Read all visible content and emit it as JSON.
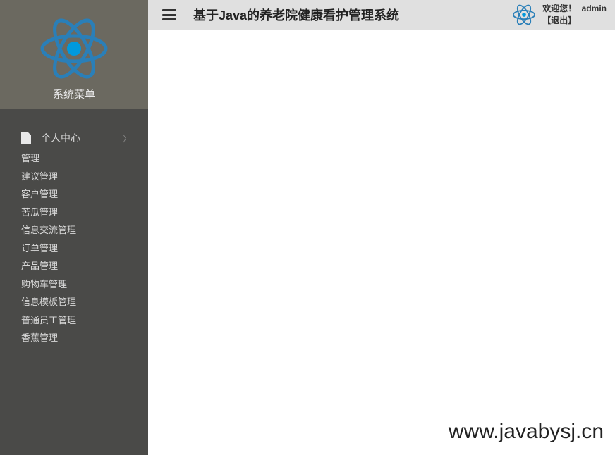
{
  "sidebar": {
    "title": "系统菜单",
    "parent_item": "个人中心",
    "items": [
      "管理",
      "建议管理",
      "客户管理",
      "苦瓜管理",
      "信息交流管理",
      "订单管理",
      "产品管理",
      "购物车管理",
      "信息模板管理",
      "普通员工管理",
      "香蕉管理"
    ]
  },
  "header": {
    "title": "基于Java的养老院健康看护管理系统",
    "welcome_prefix": "欢迎您！",
    "username": "admin",
    "logout": "【退出】"
  },
  "watermark": "www.javabysj.cn"
}
